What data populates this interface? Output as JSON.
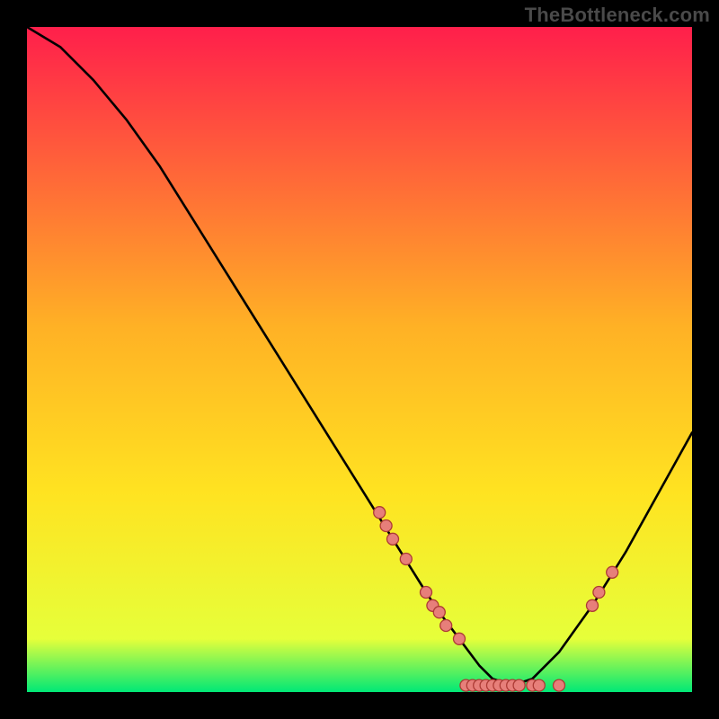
{
  "watermark": "TheBottleneck.com",
  "colors": {
    "background": "#000000",
    "gradient_top": "#ff1f4b",
    "gradient_mid": "#ffe321",
    "gradient_bottom": "#00e876",
    "curve": "#000000",
    "marker_fill": "#e77f7a",
    "marker_stroke": "#ad3b35"
  },
  "chart_data": {
    "type": "line",
    "title": "",
    "xlabel": "",
    "ylabel": "",
    "xlim": [
      0,
      100
    ],
    "ylim": [
      0,
      100
    ],
    "curve": {
      "x": [
        0,
        5,
        10,
        15,
        20,
        25,
        30,
        35,
        40,
        45,
        50,
        55,
        60,
        62,
        65,
        68,
        70,
        73,
        76,
        80,
        85,
        90,
        95,
        100
      ],
      "y": [
        100,
        97,
        92,
        86,
        79,
        71,
        63,
        55,
        47,
        39,
        31,
        23,
        15,
        12,
        8,
        4,
        2,
        1,
        2,
        6,
        13,
        21,
        30,
        39
      ]
    },
    "markers": [
      {
        "x": 53,
        "y": 27
      },
      {
        "x": 54,
        "y": 25
      },
      {
        "x": 55,
        "y": 23
      },
      {
        "x": 57,
        "y": 20
      },
      {
        "x": 60,
        "y": 15
      },
      {
        "x": 61,
        "y": 13
      },
      {
        "x": 62,
        "y": 12
      },
      {
        "x": 63,
        "y": 10
      },
      {
        "x": 65,
        "y": 8
      },
      {
        "x": 66,
        "y": 1
      },
      {
        "x": 67,
        "y": 1
      },
      {
        "x": 68,
        "y": 1
      },
      {
        "x": 69,
        "y": 1
      },
      {
        "x": 70,
        "y": 1
      },
      {
        "x": 71,
        "y": 1
      },
      {
        "x": 72,
        "y": 1
      },
      {
        "x": 73,
        "y": 1
      },
      {
        "x": 74,
        "y": 1
      },
      {
        "x": 76,
        "y": 1
      },
      {
        "x": 77,
        "y": 1
      },
      {
        "x": 80,
        "y": 1
      },
      {
        "x": 85,
        "y": 13
      },
      {
        "x": 86,
        "y": 15
      },
      {
        "x": 88,
        "y": 18
      }
    ]
  }
}
